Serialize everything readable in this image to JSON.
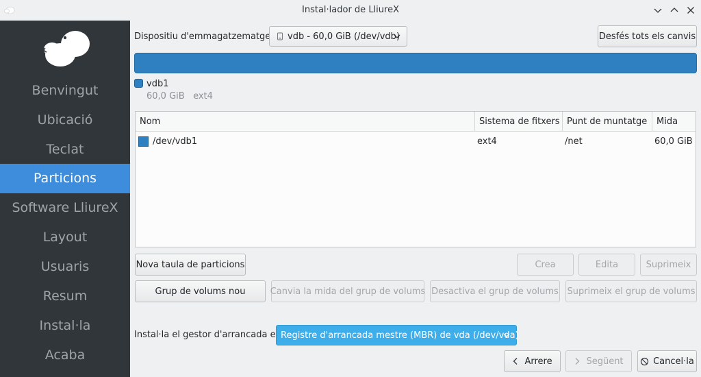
{
  "window": {
    "title": "Instal·lador de LliureX"
  },
  "sidebar": {
    "items": [
      {
        "label": "Benvingut"
      },
      {
        "label": "Ubicació"
      },
      {
        "label": "Teclat"
      },
      {
        "label": "Particions"
      },
      {
        "label": "Software LliureX"
      },
      {
        "label": "Layout"
      },
      {
        "label": "Usuaris"
      },
      {
        "label": "Resum"
      },
      {
        "label": "Instal·la"
      },
      {
        "label": "Acaba"
      }
    ],
    "active_index": 3
  },
  "storage": {
    "label": "Dispositiu d'emmagatzematge:",
    "device": "vdb - 60,0 GiB (/dev/vdb)",
    "undo_button": "Desfés tots els canvis"
  },
  "partition_legend": {
    "name": "vdb1",
    "detail": "60,0 GiB   ext4",
    "color": "#2f80c0"
  },
  "table": {
    "headers": [
      "Nom",
      "Sistema de fitxers",
      "Punt de muntatge",
      "Mida"
    ],
    "rows": [
      {
        "name": "/dev/vdb1",
        "fs": "ext4",
        "mount": "/net",
        "size": "60,0 GiB"
      }
    ]
  },
  "actions": {
    "new_table": "Nova taula de particions",
    "create": "Crea",
    "edit": "Edita",
    "delete": "Suprimeix",
    "new_vg": "Grup de volums nou",
    "resize_vg": "Canvia la mida del grup de volums",
    "deactivate_vg": "Desactiva el grup de volums",
    "delete_vg": "Suprimeix el grup de volums"
  },
  "bootloader": {
    "label": "Instal·la el gestor d'arrancada en:",
    "value": "Registre d'arrancada mestre (MBR) de vda (/dev/vda)"
  },
  "navigation": {
    "back": "Arrere",
    "next": "Següent",
    "cancel": "Cancel·la"
  },
  "colors": {
    "accent": "#3daee9",
    "sidebar_active": "#3e8ddd",
    "sidebar_bg": "#31363b"
  }
}
